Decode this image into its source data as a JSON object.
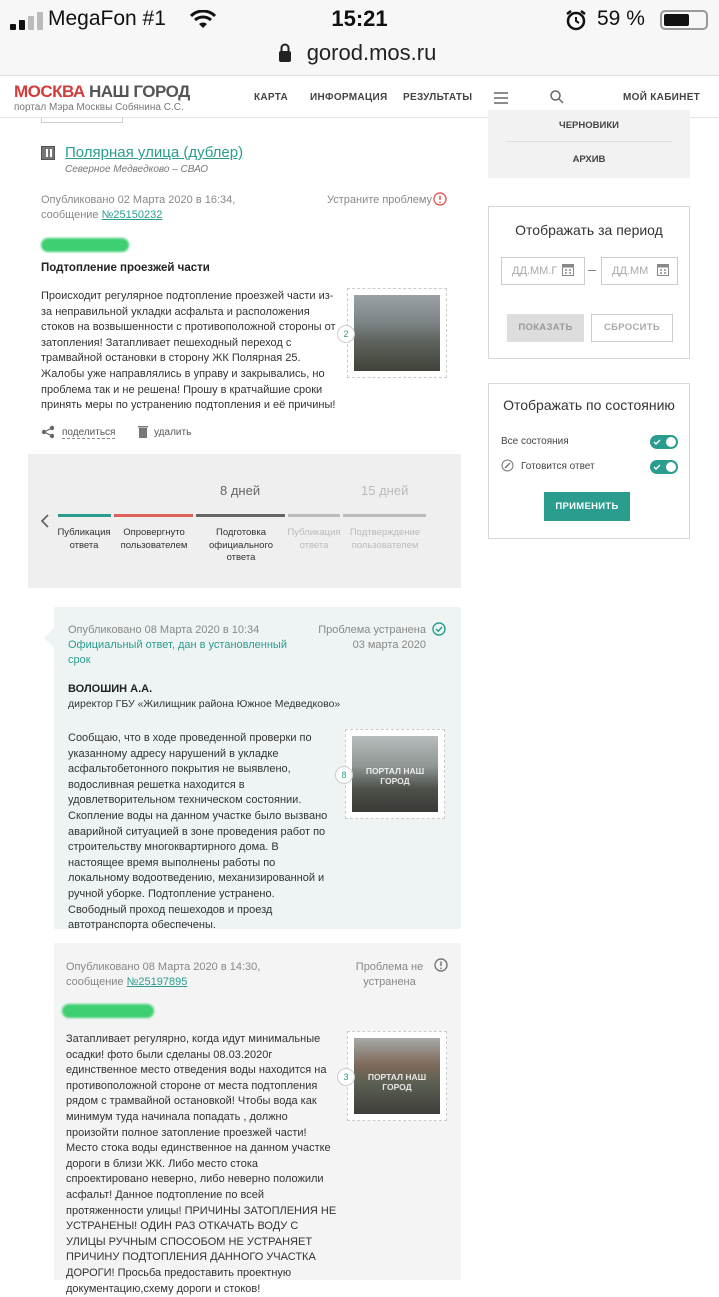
{
  "status": {
    "carrier": "MegaFon #1",
    "time": "15:21",
    "battery": "59 %"
  },
  "url": "gorod.mos.ru",
  "header": {
    "logo_red": "МОСКВА",
    "logo_dark": "НАШ ГОРОД",
    "logo_sub": "портал Мэра Москвы Собянина С.С.",
    "nav": [
      "КАРТА",
      "ИНФОРМАЦИЯ",
      "РЕЗУЛЬТАТЫ"
    ],
    "cabinet": "МОЙ КАБИНЕТ"
  },
  "sidebar": {
    "drafts": "ЧЕРНОВИКИ",
    "archive": "АРХИВ",
    "period_title": "Отображать за период",
    "date_from": "ДД.ММ.Г",
    "date_to": "ДД.ММ",
    "show": "ПОКАЗАТЬ",
    "reset": "СБРОСИТЬ",
    "state_title": "Отображать по состоянию",
    "all_states": "Все состояния",
    "preparing": "Готовится ответ",
    "apply": "ПРИМЕНИТЬ"
  },
  "object": {
    "name": "Полярная улица (дублер)",
    "area": "Северное Медведково – СВАО"
  },
  "post1": {
    "published": "Опубликовано 02 Марта 2020 в 16:34,",
    "msg_prefix": "сообщение ",
    "msg_no": "№25150232",
    "status": "Устраните проблему",
    "title": "Подтопление проезжей части",
    "text": "Происходит регулярное подтопление проезжей части из-за неправильной укладки асфальта и расположения стоков на возвышенности с противоположной стороны от затопления! Затапливает пешеходный переход с трамвайной остановки в сторону ЖК Полярная 25. Жалобы уже направлялись в управу и закрывались, но проблема так и не решена! Прошу в кратчайшие сроки принять меры по устранению подтопления и её причины!",
    "photos": "2",
    "share": "поделиться",
    "delete": "удалить"
  },
  "timeline": {
    "days1": "8 дней",
    "days2": "15 дней",
    "steps": [
      "Публикация ответа",
      "Опровергнуто пользователем",
      "Подготовка официального ответа",
      "Публикация ответа",
      "Подтверждение пользователем"
    ],
    "colors": [
      "#2a9d8f",
      "#e0605c",
      "#666666",
      "#bbbbbb",
      "#bbbbbb"
    ]
  },
  "answer": {
    "published": "Опубликовано 08 Марта 2020 в 10:34",
    "note": "Официальный ответ, дан в установленный срок",
    "status": "Проблема устранена",
    "status_date": "03 марта 2020",
    "author": "ВОЛОШИН А.А.",
    "role": "директор ГБУ «Жилищник района Южное Медведково»",
    "text": "Сообщаю, что в ходе проведенной проверки по указанному адресу нарушений в укладке асфальтобетонного покрытия не выявлено, водосливная решетка находится в удовлетворительном техническом состоянии. Скопление воды на данном участке было вызвано аварийной ситуацией в зоне проведения работ по строительству многоквартирного дома. В настоящее время выполнены работы по локальному водоотведению, механизированной и ручной уборке. Подтопление устранено. Свободный проход пешеходов и проезд автотранспорта обеспечены.",
    "photos": "8",
    "watermark": "ПОРТАЛ НАШ ГОРОД"
  },
  "post2": {
    "published": "Опубликовано 08 Марта 2020 в 14:30,",
    "msg_prefix": "сообщение ",
    "msg_no": "№25197895",
    "status": "Проблема не устранена",
    "text": "Затапливает регулярно, когда идут минимальные осадки! фото были сделаны 08.03.2020г единственное место отведения воды находится на противоположной стороне от места подтопления рядом с трамвайной остановкой! Чтобы вода как минимум туда начинала попадать , должно произойти полное затопление проезжей части! Место стока воды единственное на данном участке дороги в близи ЖК. Либо место стока спроектировано неверно, либо неверно положили асфальт! Данное подтопление по всей протяженности улицы! ПРИЧИНЫ ЗАТОПЛЕНИЯ НЕ УСТРАНЕНЫ! ОДИН РАЗ ОТКАЧАТЬ ВОДУ С УЛИЦЫ РУЧНЫМ СПОСОБОМ НЕ УСТРАНЯЕТ ПРИЧИНУ ПОДТОПЛЕНИЯ ДАННОГО УЧАСТКА ДОРОГИ! Просьба предоставить проектную документацию,схему дороги и стоков!",
    "photos": "3",
    "watermark": "ПОРТАЛ НАШ ГОРОД"
  }
}
